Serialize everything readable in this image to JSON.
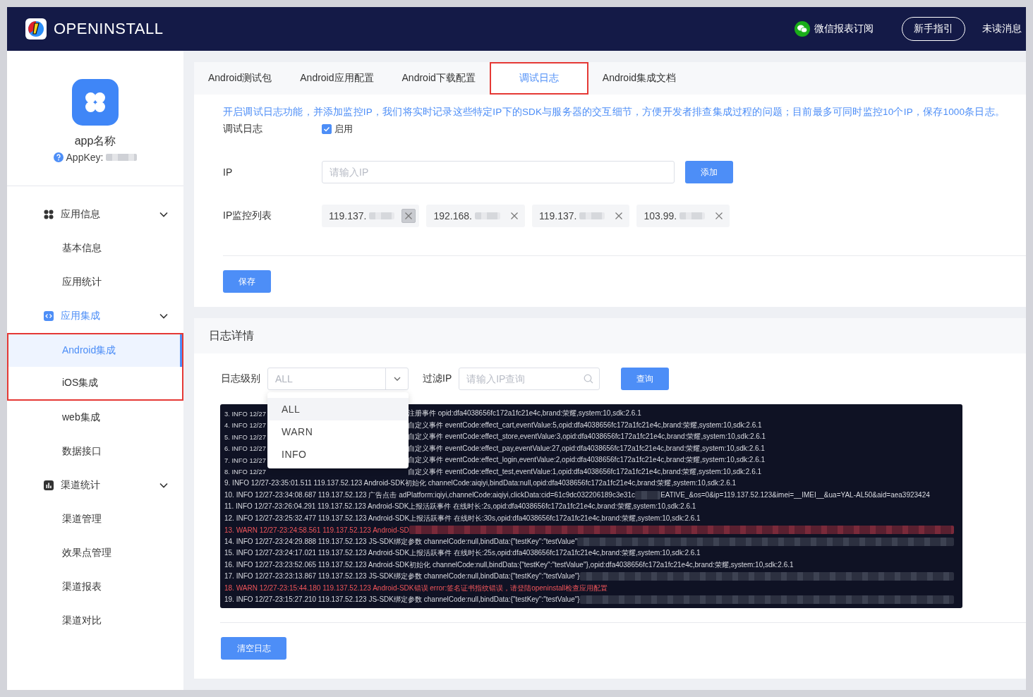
{
  "header": {
    "brand": "OPENINSTALL",
    "links": [
      {
        "kind": "wechat",
        "label": "微信报表订阅"
      },
      {
        "kind": "outlined",
        "label": "新手指引"
      },
      {
        "kind": "plain",
        "label": "未读消息"
      }
    ]
  },
  "app": {
    "name": "app名称",
    "appkey_label": "AppKey:"
  },
  "sidebar": {
    "groups": [
      {
        "label": "应用信息",
        "kind": "grid",
        "active": false,
        "expanded": true,
        "children": [
          {
            "label": "基本信息",
            "selected": false,
            "outlined": false
          },
          {
            "label": "应用统计",
            "selected": false,
            "outlined": false
          }
        ]
      },
      {
        "label": "应用集成",
        "kind": "code",
        "active": true,
        "expanded": true,
        "children": [
          {
            "label": "Android集成",
            "selected": true,
            "outlined": true
          },
          {
            "label": "iOS集成",
            "selected": false,
            "outlined": true
          },
          {
            "label": "web集成",
            "selected": false,
            "outlined": false
          },
          {
            "label": "数据接口",
            "selected": false,
            "outlined": false
          }
        ]
      },
      {
        "label": "渠道统计",
        "kind": "chart",
        "active": false,
        "expanded": true,
        "children": [
          {
            "label": "渠道管理",
            "selected": false,
            "outlined": false
          },
          {
            "label": "效果点管理",
            "selected": false,
            "outlined": false
          },
          {
            "label": "渠道报表",
            "selected": false,
            "outlined": false
          },
          {
            "label": "渠道对比",
            "selected": false,
            "outlined": false
          }
        ]
      }
    ]
  },
  "tabs": [
    {
      "label": "Android测试包",
      "selected": false,
      "outlined": false
    },
    {
      "label": "Android应用配置",
      "selected": false,
      "outlined": false
    },
    {
      "label": "Android下载配置",
      "selected": false,
      "outlined": false
    },
    {
      "label": "调试日志",
      "selected": true,
      "outlined": true
    },
    {
      "label": "Android集成文档",
      "selected": false,
      "outlined": false
    }
  ],
  "debug": {
    "notice": "开启调试日志功能，并添加监控IP，我们将实时记录这些特定IP下的SDK与服务器的交互细节，方便开发者排查集成过程的问题；目前最多可同时监控10个IP，保存1000条日志。",
    "toggle_label": "调试日志",
    "toggle": {
      "label": "启用",
      "checked": true
    },
    "ip_label": "IP",
    "ip_placeholder": "请输入IP",
    "add_button": "添加",
    "list_label": "IP监控列表",
    "ips": [
      {
        "prefix": "119.137.",
        "close_hover": true
      },
      {
        "prefix": "192.168.",
        "close_hover": false
      },
      {
        "prefix": "119.137.",
        "close_hover": false
      },
      {
        "prefix": "103.99.",
        "close_hover": false
      }
    ],
    "save_button": "保存"
  },
  "log": {
    "title": "日志详情",
    "level_label": "日志级别",
    "level_select": {
      "value": "ALL",
      "expanded": true,
      "options": [
        {
          "label": "ALL",
          "selected": true
        },
        {
          "label": "WARN",
          "selected": false
        },
        {
          "label": "INFO",
          "selected": false
        }
      ]
    },
    "filter_label": "过滤IP",
    "filter_placeholder": "请输入IP查询",
    "query_button": "查询",
    "lines": [
      {
        "warning": false,
        "parts": [
          {
            "kind": "text",
            "text": "3. INFO 12/27"
          },
          {
            "kind": "covered"
          },
          {
            "kind": "text",
            "text": "注册事件 opid:dfa4038656fc172a1fc21e4c,brand:荣耀,system:10,sdk:2.6.1"
          }
        ]
      },
      {
        "warning": false,
        "parts": [
          {
            "kind": "text",
            "text": "4. INFO 12/27"
          },
          {
            "kind": "covered"
          },
          {
            "kind": "text",
            "text": "自定义事件 eventCode:effect_cart,eventValue:5,opid:dfa4038656fc172a1fc21e4c,brand:荣耀,system:10,sdk:2.6.1"
          }
        ]
      },
      {
        "warning": false,
        "parts": [
          {
            "kind": "text",
            "text": "5. INFO 12/27"
          },
          {
            "kind": "covered"
          },
          {
            "kind": "text",
            "text": "自定义事件 eventCode:effect_store,eventValue:3,opid:dfa4038656fc172a1fc21e4c,brand:荣耀,system:10,sdk:2.6.1"
          }
        ]
      },
      {
        "warning": false,
        "parts": [
          {
            "kind": "text",
            "text": "6. INFO 12/27"
          },
          {
            "kind": "covered"
          },
          {
            "kind": "text",
            "text": "自定义事件 eventCode:effect_pay,eventValue:27,opid:dfa4038656fc172a1fc21e4c,brand:荣耀,system:10,sdk:2.6.1"
          }
        ]
      },
      {
        "warning": false,
        "parts": [
          {
            "kind": "text",
            "text": "7. INFO 12/27"
          },
          {
            "kind": "covered"
          },
          {
            "kind": "text",
            "text": "自定义事件 eventCode:effect_login,eventValue:2,opid:dfa4038656fc172a1fc21e4c,brand:荣耀,system:10,sdk:2.6.1"
          }
        ]
      },
      {
        "warning": false,
        "parts": [
          {
            "kind": "text",
            "text": "8. INFO 12/27"
          },
          {
            "kind": "covered"
          },
          {
            "kind": "text",
            "text": "自定义事件 eventCode:effect_test,eventValue:1,opid:dfa4038656fc172a1fc21e4c,brand:荣耀,system:10,sdk:2.6.1"
          }
        ]
      },
      {
        "warning": false,
        "parts": [
          {
            "kind": "text",
            "text": "9. INFO 12/27-23:35:01.511 119.137.52.123 Android-SDK初始化 channelCode:aiqiyi,bindData:null,opid:dfa4038656fc172a1fc21e4c,brand:荣耀,system:10,sdk:2.6.1"
          }
        ]
      },
      {
        "warning": false,
        "parts": [
          {
            "kind": "text",
            "text": "10. INFO 12/27-23:34:08.687 119.137.52.123 广告点击 adPlatform:iqiyi,channelCode:aiqiyi,clickData:cid=61c9dc032206189c3e31c"
          },
          {
            "kind": "blur"
          },
          {
            "kind": "text",
            "text": "EATIVE_&os=0&ip=119.137.52.123&imei=__IMEI__&ua=YAL-AL50&aid=aea3923424"
          }
        ]
      },
      {
        "warning": false,
        "parts": [
          {
            "kind": "text",
            "text": "11. INFO 12/27-23:26:04.291 119.137.52.123 Android-SDK上报活跃事件 在线时长:2s,opid:dfa4038656fc172a1fc21e4c,brand:荣耀,system:10,sdk:2.6.1"
          }
        ]
      },
      {
        "warning": false,
        "parts": [
          {
            "kind": "text",
            "text": "12. INFO 12/27-23:25:32.477 119.137.52.123 Android-SDK上报活跃事件 在线时长:30s,opid:dfa4038656fc172a1fc21e4c,brand:荣耀,system:10,sdk:2.6.1"
          }
        ]
      },
      {
        "warning": true,
        "parts": [
          {
            "kind": "text",
            "text": "13. WARN 12/27-23:24:58.561 119.137.52.123 Android-SD"
          },
          {
            "kind": "blur"
          }
        ]
      },
      {
        "warning": false,
        "parts": [
          {
            "kind": "text",
            "text": "14. INFO 12/27-23:24:29.888 119.137.52.123 JS-SDK绑定参数 channelCode:null,bindData:{\"testKey\":\"testValue\""
          },
          {
            "kind": "blur"
          }
        ]
      },
      {
        "warning": false,
        "parts": [
          {
            "kind": "text",
            "text": "15. INFO 12/27-23:24:17.021 119.137.52.123 Android-SDK上报活跃事件 在线时长:25s,opid:dfa4038656fc172a1fc21e4c,brand:荣耀,system:10,sdk:2.6.1"
          }
        ]
      },
      {
        "warning": false,
        "parts": [
          {
            "kind": "text",
            "text": "16. INFO 12/27-23:23:52.065 119.137.52.123 Android-SDK初始化 channelCode:null,bindData:{\"testKey\":\"testValue\"},opid:dfa4038656fc172a1fc21e4c,brand:荣耀,system:10,sdk:2.6.1"
          }
        ]
      },
      {
        "warning": false,
        "parts": [
          {
            "kind": "text",
            "text": "17. INFO 12/27-23:23:13.867 119.137.52.123 JS-SDK绑定参数 channelCode:null,bindData:{\"testKey\":\"testValue\"}"
          },
          {
            "kind": "blur"
          }
        ]
      },
      {
        "warning": true,
        "parts": [
          {
            "kind": "text",
            "text": "18. WARN 12/27-23:15:44.180 119.137.52.123 Android-SDK错误 error:签名证书指纹错误，请登陆openinstall检查应用配置"
          }
        ]
      },
      {
        "warning": false,
        "parts": [
          {
            "kind": "text",
            "text": "19. INFO 12/27-23:15:27.210 119.137.52.123 JS-SDK绑定参数 channelCode:null,bindData:{\"testKey\":\"testValue\"}"
          },
          {
            "kind": "blur"
          }
        ]
      }
    ],
    "clear_button": "清空日志"
  }
}
